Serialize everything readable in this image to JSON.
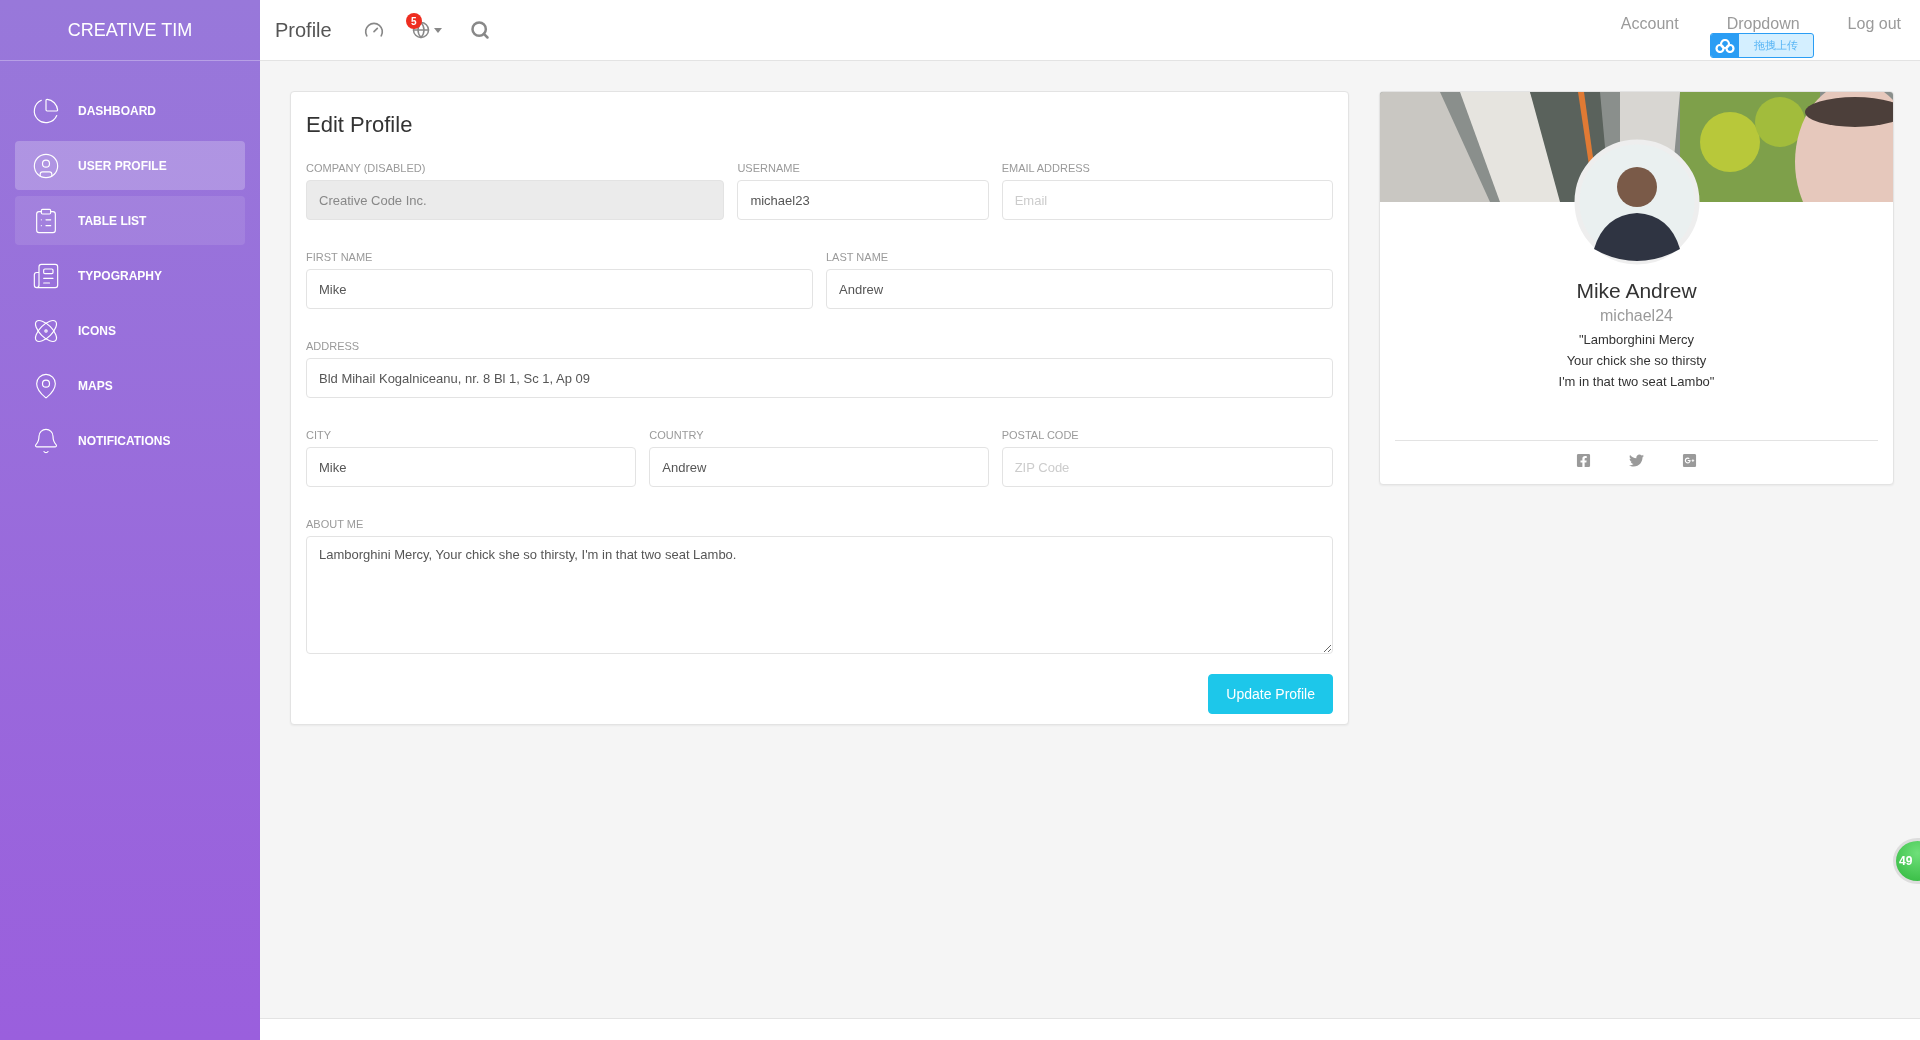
{
  "sidebar": {
    "brand": "CREATIVE TIM",
    "items": [
      {
        "label": "DASHBOARD",
        "selected": false,
        "hovered": false
      },
      {
        "label": "USER PROFILE",
        "selected": true,
        "hovered": false
      },
      {
        "label": "TABLE LIST",
        "selected": false,
        "hovered": true
      },
      {
        "label": "TYPOGRAPHY",
        "selected": false,
        "hovered": false
      },
      {
        "label": "ICONS",
        "selected": false,
        "hovered": false
      },
      {
        "label": "MAPS",
        "selected": false,
        "hovered": false
      },
      {
        "label": "NOTIFICATIONS",
        "selected": false,
        "hovered": false
      }
    ]
  },
  "navbar": {
    "title": "Profile",
    "notification_count": "5",
    "links": [
      "Account",
      "Dropdown",
      "Log out"
    ]
  },
  "upload_widget": {
    "label": "拖拽上传"
  },
  "edit_profile": {
    "title": "Edit Profile",
    "rows": [
      [
        {
          "label": "COMPANY (DISABLED)",
          "value": "Creative Code Inc.",
          "disabled": true
        },
        {
          "label": "USERNAME",
          "value": "michael23"
        },
        {
          "label": "EMAIL ADDRESS",
          "placeholder": "Email"
        }
      ],
      [
        {
          "label": "FIRST NAME",
          "value": "Mike"
        },
        {
          "label": "LAST NAME",
          "value": "Andrew"
        }
      ],
      [
        {
          "label": "ADDRESS",
          "value": "Bld Mihail Kogalniceanu, nr. 8 Bl 1, Sc 1, Ap 09"
        }
      ],
      [
        {
          "label": "CITY",
          "value": "Mike"
        },
        {
          "label": "COUNTRY",
          "value": "Andrew"
        },
        {
          "label": "POSTAL CODE",
          "placeholder": "ZIP Code"
        }
      ]
    ],
    "about": {
      "label": "ABOUT ME",
      "value": "Lamborghini Mercy, Your chick she so thirsty, I'm in that two seat Lambo."
    },
    "button": "Update Profile"
  },
  "profile_card": {
    "name": "Mike Andrew",
    "username": "michael24",
    "quote": [
      "\"Lamborghini Mercy",
      "Your chick she so thirsty",
      "I'm in that two seat Lambo\""
    ]
  },
  "floating_badge": "49"
}
